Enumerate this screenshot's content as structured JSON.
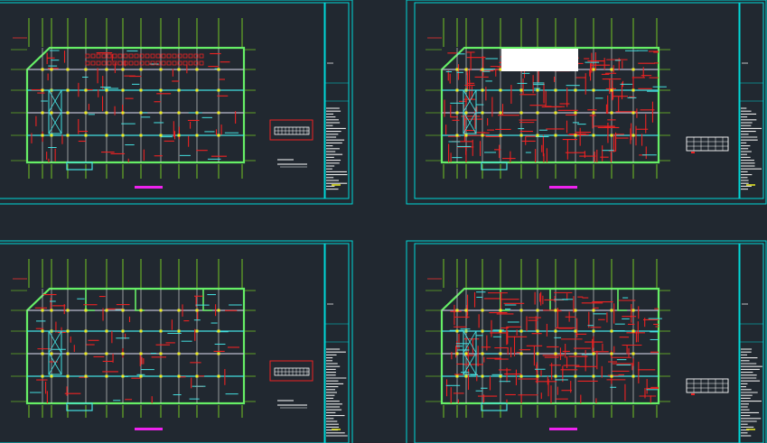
{
  "canvas": {
    "background": "#212830",
    "sheet_count": 4
  },
  "colors": {
    "frame": "#00d8d8",
    "beam": "#66ee66",
    "grid_line": "#88ee22",
    "axis": "#ee3333",
    "rebar": "#ee2222",
    "column": "#eeee22",
    "cyan": "#44e0e0",
    "white": "#ffffff",
    "magenta": "#ee22ee",
    "title_block_text": "#e8e8e8"
  },
  "sheets": [
    {
      "id": "sheet-top-left",
      "variant": "beam-plan-a",
      "has_white_block": false,
      "legend_boxed": true
    },
    {
      "id": "sheet-top-right",
      "variant": "rebar-plan-a",
      "has_white_block": true,
      "legend_boxed": false
    },
    {
      "id": "sheet-bottom-left",
      "variant": "beam-plan-b",
      "has_white_block": false,
      "legend_boxed": true
    },
    {
      "id": "sheet-bottom-right",
      "variant": "rebar-plan-b",
      "has_white_block": false,
      "legend_boxed": false
    }
  ]
}
